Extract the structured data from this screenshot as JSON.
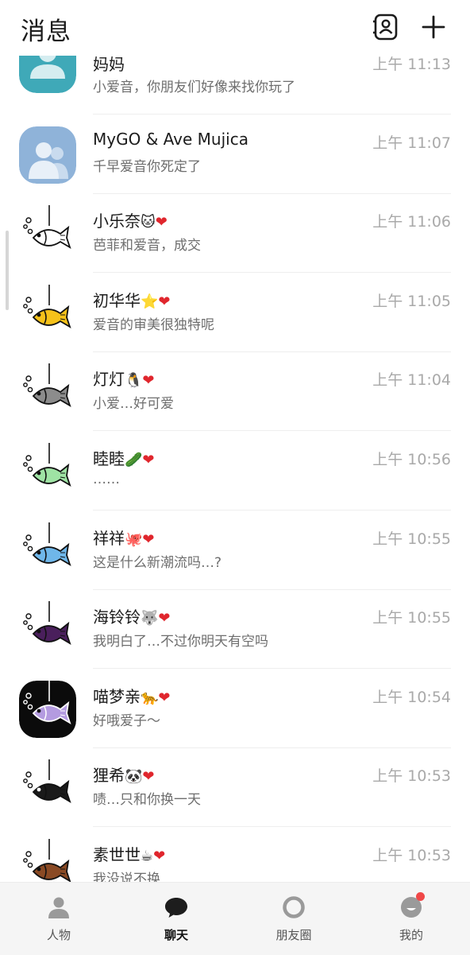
{
  "header": {
    "title": "消息"
  },
  "chats": [
    {
      "name": "妈妈",
      "name_emoji": "",
      "heart": "",
      "preview": "小爱音，你朋友们好像来找你玩了",
      "time": "上午 11:13",
      "avatar": "person-teal"
    },
    {
      "name": "MyGO & Ave Mujica",
      "name_emoji": "",
      "heart": "",
      "preview": "千早爱音你死定了",
      "time": "上午 11:07",
      "avatar": "group-blue"
    },
    {
      "name": "小乐奈",
      "name_emoji": "🐱",
      "heart": "❤",
      "preview": "芭菲和爱音，成交",
      "time": "上午 11:06",
      "avatar": "fish",
      "fish_color": "#ffffff"
    },
    {
      "name": "初华华",
      "name_emoji": "⭐",
      "heart": "❤",
      "preview": "爱音的审美很独特呢",
      "time": "上午 11:05",
      "avatar": "fish",
      "fish_color": "#f6c21a"
    },
    {
      "name": "灯灯",
      "name_emoji": "🐧",
      "heart": "❤",
      "preview": "小爱…好可爱",
      "time": "上午 11:04",
      "avatar": "fish",
      "fish_color": "#8c8c8c"
    },
    {
      "name": "睦睦",
      "name_emoji": "🥒",
      "heart": "❤",
      "preview": "……",
      "time": "上午 10:56",
      "avatar": "fish",
      "fish_color": "#9fe3a4"
    },
    {
      "name": "祥祥",
      "name_emoji": "🐙",
      "heart": "❤",
      "preview": "这是什么新潮流吗…?",
      "time": "上午 10:55",
      "avatar": "fish",
      "fish_color": "#6fb7ea"
    },
    {
      "name": "海铃铃",
      "name_emoji": "🐺",
      "heart": "❤",
      "preview": "我明白了…不过你明天有空吗",
      "time": "上午 10:55",
      "avatar": "fish",
      "fish_color": "#4a1f5c"
    },
    {
      "name": "喵梦亲",
      "name_emoji": "🐆",
      "heart": "❤",
      "preview": "好哦爱子～",
      "time": "上午 10:54",
      "avatar": "fish-dark",
      "fish_color": "#b49be0"
    },
    {
      "name": "狸希",
      "name_emoji": "🐼",
      "heart": "❤",
      "preview": "啧…只和你换一天",
      "time": "上午 10:53",
      "avatar": "fish",
      "fish_color": "#1a1a1a"
    },
    {
      "name": "素世世",
      "name_emoji": "☕",
      "heart": "❤",
      "preview": "我没说不换",
      "time": "上午 10:53",
      "avatar": "fish",
      "fish_color": "#8a4a24"
    }
  ],
  "tabs": [
    {
      "label": "人物",
      "icon": "person-icon",
      "active": false
    },
    {
      "label": "聊天",
      "icon": "chat-bubble-icon",
      "active": true
    },
    {
      "label": "朋友圈",
      "icon": "moments-ring-icon",
      "active": false
    },
    {
      "label": "我的",
      "icon": "me-face-icon",
      "active": false,
      "badge": true
    }
  ],
  "colors": {
    "heart": "#e0262d",
    "badge": "#f04848",
    "teal_avatar": "#3fa9b8",
    "blue_avatar": "#8fb3d9"
  }
}
